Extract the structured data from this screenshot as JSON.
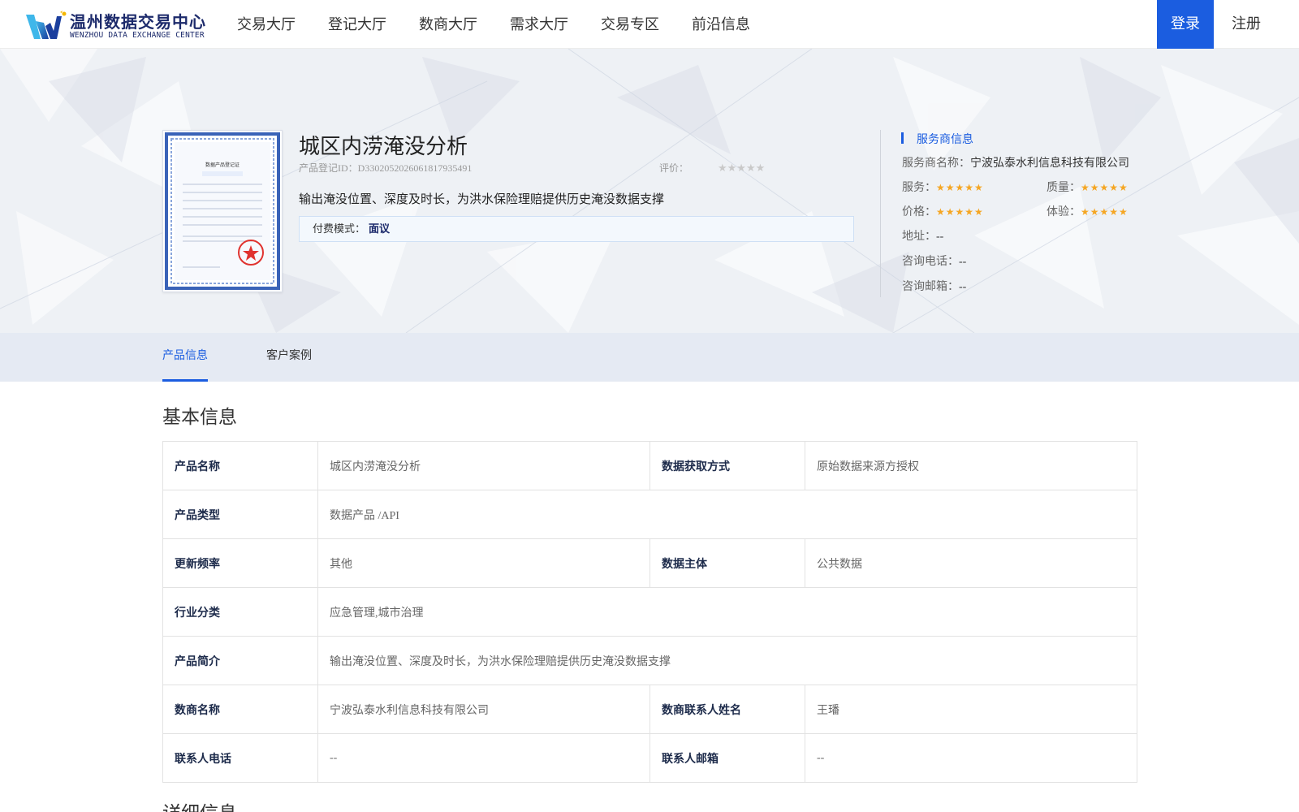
{
  "header": {
    "logo_cn": "温州数据交易中心",
    "logo_en": "WENZHOU DATA EXCHANGE CENTER",
    "nav": [
      "交易大厅",
      "登记大厅",
      "数商大厅",
      "需求大厅",
      "交易专区",
      "前沿信息"
    ],
    "login": "登录",
    "register": "注册"
  },
  "product": {
    "title": "城区内涝淹没分析",
    "id_label": "产品登记ID：",
    "id": "D3302052026061817935491",
    "rating_label": "评价：",
    "rating_stars": "★★★★★",
    "rating_value": 0,
    "description": "输出淹没位置、深度及时长，为洪水保险理赔提供历史淹没数据支撑",
    "pay_label": "付费模式：",
    "pay_value": "面议"
  },
  "vendor": {
    "heading": "服务商信息",
    "name_label": "服务商名称：",
    "name": "宁波弘泰水利信息科技有限公司",
    "service_label": "服务：",
    "quality_label": "质量：",
    "price_label": "价格：",
    "experience_label": "体验：",
    "stars": "★★★★★",
    "service_rating": 5,
    "quality_rating": 5,
    "price_rating": 5,
    "experience_rating": 5,
    "address_label": "地址：",
    "address": "--",
    "phone_label": "咨询电话：",
    "phone": "--",
    "email_label": "咨询邮箱：",
    "email": "--"
  },
  "tabs": [
    "产品信息",
    "客户案例"
  ],
  "basic_info": {
    "title": "基本信息",
    "rows": [
      [
        {
          "k": "产品名称",
          "v": "城区内涝淹没分析"
        },
        {
          "k": "数据获取方式",
          "v": "原始数据来源方授权"
        }
      ],
      [
        {
          "k": "产品类型",
          "v": "数据产品 /API"
        }
      ],
      [
        {
          "k": "更新频率",
          "v": "其他"
        },
        {
          "k": "数据主体",
          "v": "公共数据"
        }
      ],
      [
        {
          "k": "行业分类",
          "v": "应急管理,城市治理"
        }
      ],
      [
        {
          "k": "产品简介",
          "v": "输出淹没位置、深度及时长，为洪水保险理赔提供历史淹没数据支撑"
        }
      ],
      [
        {
          "k": "数商名称",
          "v": "宁波弘泰水利信息科技有限公司"
        },
        {
          "k": "数商联系人姓名",
          "v": "王璠"
        }
      ],
      [
        {
          "k": "联系人电话",
          "v": "--"
        },
        {
          "k": "联系人邮箱",
          "v": "--"
        }
      ]
    ]
  },
  "detail_title": "详细信息",
  "colors": {
    "brand_blue": "#1b5de0",
    "dark_navy": "#1c2a6b",
    "star_gold": "#f5a623",
    "star_gray": "#c9c9c9",
    "tab_bar_bg": "#e5eaf3",
    "hero_bg": "#eef1f5"
  },
  "icons": {
    "logo": "wenzhou-logo-icon",
    "certificate": "certificate-image",
    "star": "star-icon"
  }
}
